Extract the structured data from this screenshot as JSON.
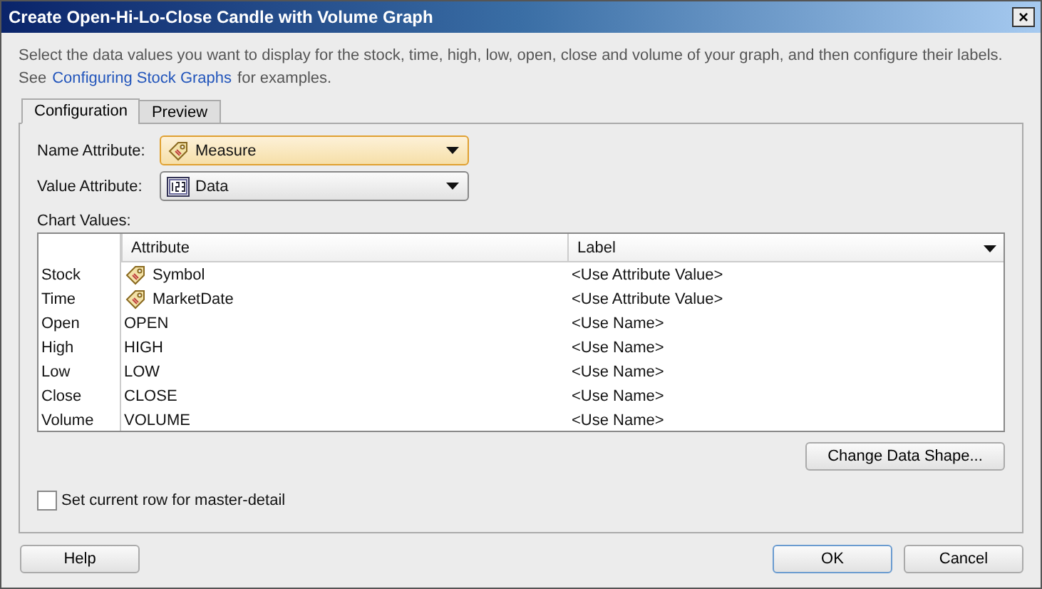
{
  "window": {
    "title": "Create Open-Hi-Lo-Close Candle with Volume Graph",
    "close": "×"
  },
  "description": {
    "text": "Select the data values you want to display for the stock, time, high, low, open, close and volume of your graph, and then configure their labels.",
    "prefix": "See",
    "link": "Configuring Stock Graphs",
    "suffix": "for examples."
  },
  "tabs": [
    {
      "label": "Configuration",
      "selected": true
    },
    {
      "label": "Preview",
      "selected": false
    }
  ],
  "fields": [
    {
      "label": "Name Attribute:",
      "value": "Measure",
      "kind": "tag",
      "focused": true
    },
    {
      "label": "Value Attribute:",
      "value": "Data",
      "kind": "number",
      "focused": false
    }
  ],
  "chart_values_label": "Chart Values:",
  "table": {
    "columns": [
      "Attribute",
      "Label"
    ],
    "rows": [
      {
        "header": "Stock",
        "attribute": "Symbol",
        "kind": "tag",
        "label": "<Use Attribute Value>"
      },
      {
        "header": "Time",
        "attribute": "MarketDate",
        "kind": "tag",
        "label": "<Use Attribute Value>"
      },
      {
        "header": "Open",
        "attribute": "OPEN",
        "kind": "plain",
        "label": "<Use Name>"
      },
      {
        "header": "High",
        "attribute": "HIGH",
        "kind": "plain",
        "label": "<Use Name>"
      },
      {
        "header": "Low",
        "attribute": "LOW",
        "kind": "plain",
        "label": "<Use Name>"
      },
      {
        "header": "Close",
        "attribute": "CLOSE",
        "kind": "plain",
        "label": "<Use Name>"
      },
      {
        "header": "Volume",
        "attribute": "VOLUME",
        "kind": "plain",
        "label": "<Use Name>"
      }
    ]
  },
  "change_button": "Change Data Shape...",
  "master_detail": {
    "label": "Set current row for master-detail",
    "checked": false
  },
  "buttons": [
    {
      "label": "Help",
      "default": false
    },
    {
      "label": "OK",
      "default": true
    },
    {
      "label": "Cancel",
      "default": false
    }
  ]
}
